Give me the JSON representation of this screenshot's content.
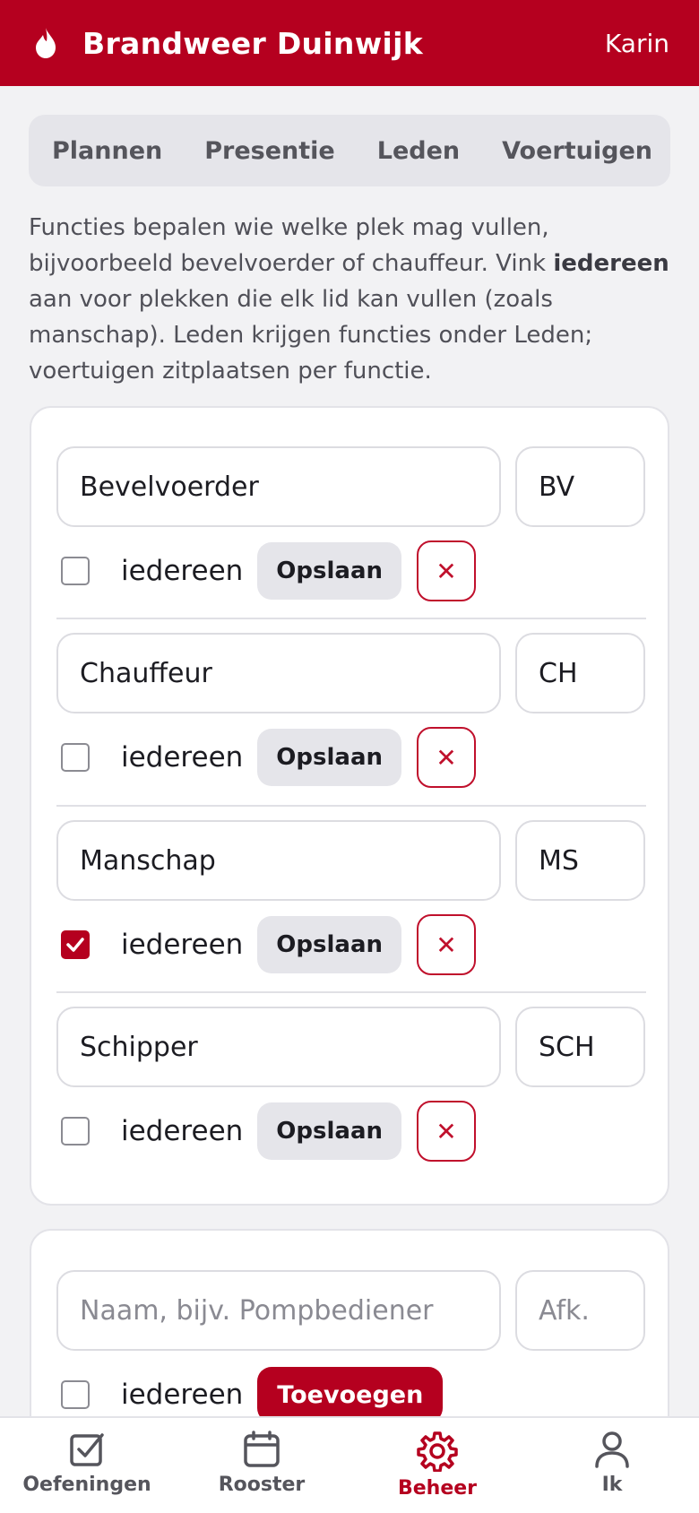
{
  "header": {
    "title": "Brandweer Duinwijk",
    "user": "Karin",
    "icon": "flame-icon"
  },
  "tabs": [
    {
      "label": "Plannen"
    },
    {
      "label": "Presentie"
    },
    {
      "label": "Leden"
    },
    {
      "label": "Voertuigen"
    }
  ],
  "intro": {
    "part1": "Functies bepalen wie welke plek mag vullen, bijvoorbeeld bevelvoerder of chauffeur. Vink ",
    "bold": "iedereen",
    "part2": " aan voor plekken die elk lid kan vullen (zoals manschap). Leden krijgen functies onder Leden; voertuigen zitplaatsen per functie."
  },
  "functions": [
    {
      "name": "Bevelvoerder",
      "abbr": "BV",
      "everyone": false,
      "everyone_label": "iedereen",
      "save_label": "Opslaan",
      "delete_label": "✕"
    },
    {
      "name": "Chauffeur",
      "abbr": "CH",
      "everyone": false,
      "everyone_label": "iedereen",
      "save_label": "Opslaan",
      "delete_label": "✕"
    },
    {
      "name": "Manschap",
      "abbr": "MS",
      "everyone": true,
      "everyone_label": "iedereen",
      "save_label": "Opslaan",
      "delete_label": "✕"
    },
    {
      "name": "Schipper",
      "abbr": "SCH",
      "everyone": false,
      "everyone_label": "iedereen",
      "save_label": "Opslaan",
      "delete_label": "✕"
    }
  ],
  "new_function": {
    "name_placeholder": "Naam, bijv. Pompbediener",
    "abbr_placeholder": "Afk.",
    "everyone_label": "iedereen",
    "add_label": "Toevoegen"
  },
  "nav": [
    {
      "label": "Oefeningen",
      "icon": "checkbox-icon",
      "active": false
    },
    {
      "label": "Rooster",
      "icon": "calendar-icon",
      "active": false
    },
    {
      "label": "Beheer",
      "icon": "gear-icon",
      "active": true
    },
    {
      "label": "Ik",
      "icon": "person-icon",
      "active": false
    }
  ],
  "colors": {
    "brand": "#b5001f",
    "background": "#f2f2f4",
    "tab_bg": "#e5e5ea"
  }
}
